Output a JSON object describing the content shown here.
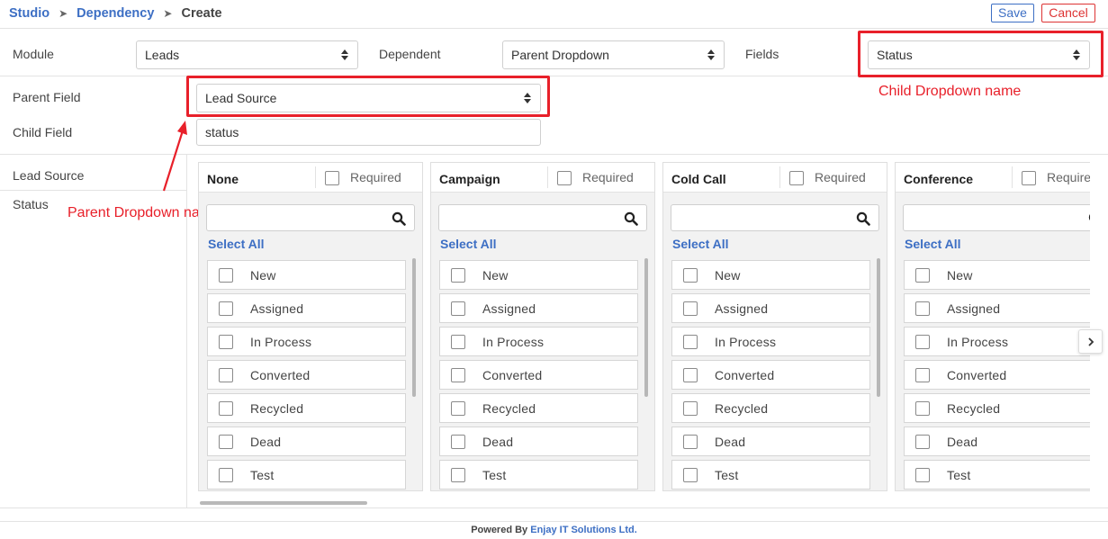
{
  "breadcrumb": {
    "studio": "Studio",
    "dependency": "Dependency",
    "create": "Create",
    "separator": "➤"
  },
  "toolbar": {
    "save_label": "Save",
    "cancel_label": "Cancel"
  },
  "form": {
    "module_label": "Module",
    "module_value": "Leads",
    "dependent_label": "Dependent",
    "dependent_value": "Parent Dropdown",
    "fields_label": "Fields",
    "fields_value": "Status",
    "parent_field_label": "Parent Field",
    "parent_field_value": "Lead Source",
    "child_field_label": "Child Field",
    "child_field_value": "status"
  },
  "side_nav": {
    "lead_source": "Lead Source",
    "status": "Status"
  },
  "annotations": {
    "child": "Child Dropdown name",
    "parent": "Parent Dropdown name",
    "color": "#e8202a"
  },
  "columns": [
    {
      "title": "None",
      "required_label": "Required",
      "select_all": "Select All",
      "items": [
        "New",
        "Assigned",
        "In Process",
        "Converted",
        "Recycled",
        "Dead",
        "Test"
      ]
    },
    {
      "title": "Campaign",
      "required_label": "Required",
      "select_all": "Select All",
      "items": [
        "New",
        "Assigned",
        "In Process",
        "Converted",
        "Recycled",
        "Dead",
        "Test"
      ]
    },
    {
      "title": "Cold Call",
      "required_label": "Required",
      "select_all": "Select All",
      "items": [
        "New",
        "Assigned",
        "In Process",
        "Converted",
        "Recycled",
        "Dead",
        "Test"
      ]
    },
    {
      "title": "Conference",
      "required_label": "Required",
      "select_all": "Select All",
      "items": [
        "New",
        "Assigned",
        "In Process",
        "Converted",
        "Recycled",
        "Dead",
        "Test"
      ]
    }
  ],
  "icons": {
    "search": "search-icon",
    "next": "chevron-right-icon",
    "select": "updown-arrows-icon"
  },
  "footer": {
    "prefix": "Powered By ",
    "company": "Enjay IT Solutions Ltd."
  },
  "colors": {
    "link": "#3d6fc4",
    "cancel": "#dd3333",
    "annotation": "#e8202a"
  }
}
